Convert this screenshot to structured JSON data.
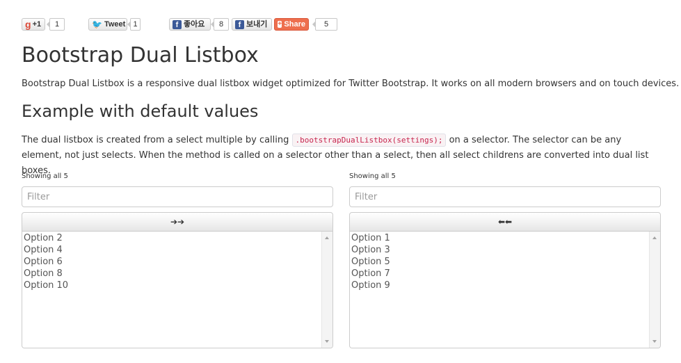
{
  "social": {
    "gplus": {
      "label": "+1",
      "count": "1"
    },
    "tweet": {
      "label": "Tweet",
      "count": "1"
    },
    "fb_like": {
      "label": "좋아요",
      "count": "8"
    },
    "fb_send": {
      "label": "보내기"
    },
    "share": {
      "label": "Share",
      "count": "5"
    }
  },
  "header": {
    "title": "Bootstrap Dual Listbox",
    "lead": "Bootstrap Dual Listbox is a responsive dual listbox widget optimized for Twitter Bootstrap. It works on all modern browsers and on touch devices."
  },
  "example": {
    "heading": "Example with default values",
    "text_before": "The dual listbox is created from a select multiple by calling",
    "code": ".bootstrapDualListbox(settings);",
    "text_after": "on a selector. The selector can be any element, not just selects. When the method is called on a selector other than a select, then all select childrens are converted into dual list boxes."
  },
  "left_box": {
    "info": "Showing all 5",
    "filter_placeholder": "Filter",
    "move_label": "➔➔",
    "options": [
      "Option 2",
      "Option 4",
      "Option 6",
      "Option 8",
      "Option 10"
    ]
  },
  "right_box": {
    "info": "Showing all 5",
    "filter_placeholder": "Filter",
    "move_label": "⬅⬅",
    "options": [
      "Option 1",
      "Option 3",
      "Option 5",
      "Option 7",
      "Option 9"
    ]
  },
  "colors": {
    "share_orange": "#ee6f4e",
    "facebook_blue": "#3b5998",
    "twitter_blue": "#2ea2dd",
    "gplus_red": "#dd4b39",
    "code_text": "#c7254e"
  }
}
